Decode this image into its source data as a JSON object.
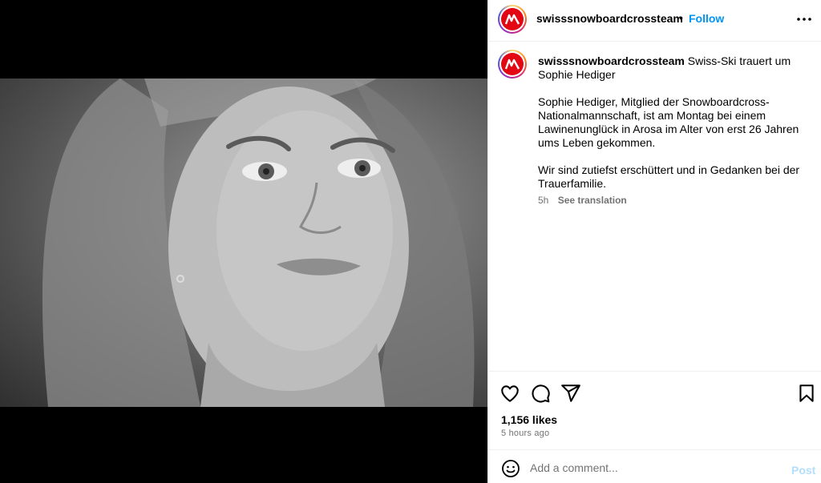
{
  "post": {
    "username": "swisssnowboardcrossteam",
    "follow_label": "Follow",
    "dot": "•",
    "caption_title": "Swiss-Ski trauert um Sophie Hediger",
    "caption_p1": "Sophie Hediger, Mitglied der Snowboardcross-Nationalmannschaft, ist am Montag bei einem Lawinenunglück in Arosa im Alter von erst 26 Jahren ums Leben gekommen.",
    "caption_p2": "Wir sind zutiefst erschüttert und in Gedanken bei der Trauerfamilie.",
    "caption_age": "5h",
    "see_translation": "See translation",
    "likes": "1,156 likes",
    "time_ago": "5 hours ago"
  },
  "comment": {
    "placeholder": "Add a comment...",
    "post_label": "Post"
  },
  "icons": {
    "more": "more-options-icon",
    "like": "heart-icon",
    "comment": "comment-icon",
    "share": "share-icon",
    "save": "bookmark-icon",
    "emoji": "emoji-icon"
  },
  "colors": {
    "accent": "#0095f6",
    "post_disabled": "#b2dffc",
    "brand_red": "#e30613"
  }
}
